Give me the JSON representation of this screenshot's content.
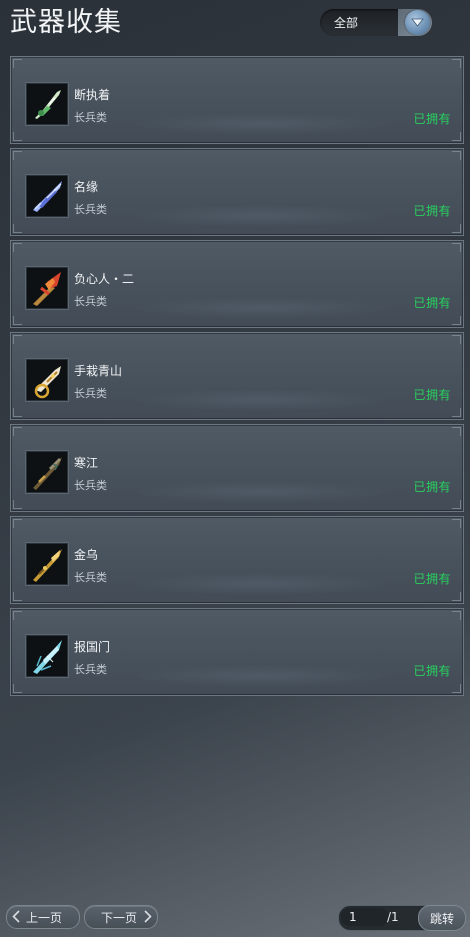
{
  "header": {
    "title": "武器收集",
    "filter": {
      "selected": "全部",
      "icon": "chevron-down-icon"
    }
  },
  "weapons": [
    {
      "name": "断执着",
      "type": "长兵类",
      "status": "已拥有",
      "icon": "jade-blade-icon"
    },
    {
      "name": "名缘",
      "type": "长兵类",
      "status": "已拥有",
      "icon": "crystal-spear-icon"
    },
    {
      "name": "负心人・二",
      "type": "长兵类",
      "status": "已拥有",
      "icon": "red-spear-icon"
    },
    {
      "name": "手栽青山",
      "type": "长兵类",
      "status": "已拥有",
      "icon": "golden-ring-blade-icon"
    },
    {
      "name": "寒江",
      "type": "长兵类",
      "status": "已拥有",
      "icon": "dark-spear-icon"
    },
    {
      "name": "金乌",
      "type": "长兵类",
      "status": "已拥有",
      "icon": "gold-spear-icon"
    },
    {
      "name": "报国门",
      "type": "长兵类",
      "status": "已拥有",
      "icon": "ice-spear-icon"
    }
  ],
  "colors": {
    "owned": "#27d05f",
    "dropdown_arrow": "#6f93b6"
  },
  "pagination": {
    "prev_label": "上一页",
    "next_label": "下一页",
    "current_page": "1",
    "total_label": "/1",
    "jump_label": "跳转"
  }
}
